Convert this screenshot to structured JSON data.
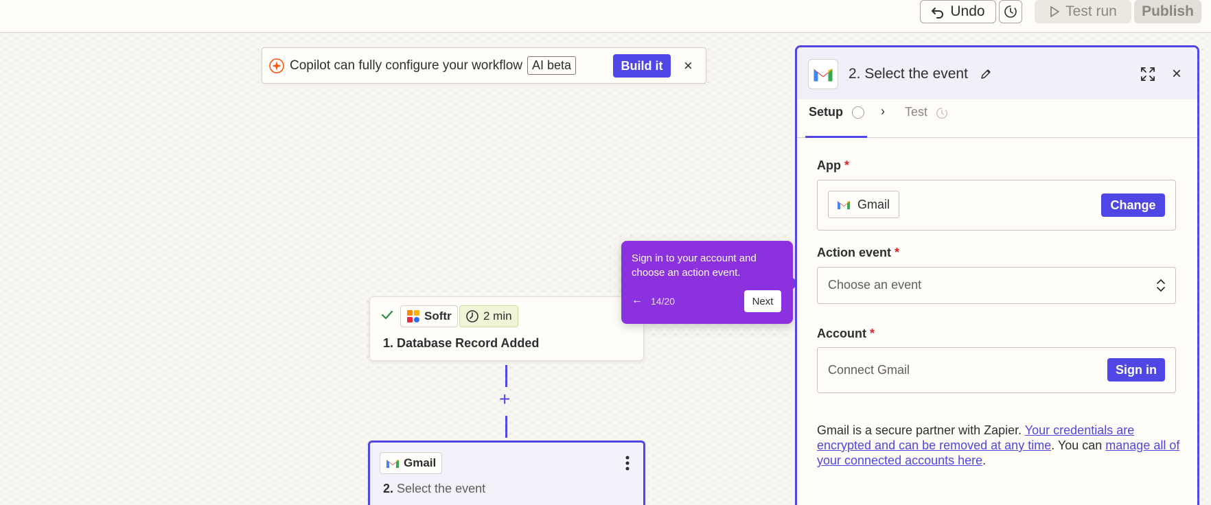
{
  "toolbar": {
    "undo_label": "Undo",
    "test_run_label": "Test run",
    "publish_label": "Publish"
  },
  "copilot": {
    "text": "Copilot can fully configure your workflow",
    "badge": "AI beta",
    "build_label": "Build it",
    "close_glyph": "×"
  },
  "steps": [
    {
      "app": "Softr",
      "duration": "2 min",
      "number": "1.",
      "title": "Database Record Added",
      "status": "complete"
    },
    {
      "app": "Gmail",
      "number": "2.",
      "title": "Select the event"
    }
  ],
  "connector": {
    "add_glyph": "+"
  },
  "tooltip": {
    "text": "Sign in to your account and choose an action event.",
    "back_glyph": "←",
    "progress": "14/20",
    "next_label": "Next"
  },
  "panel": {
    "title": "2. Select the event",
    "close_glyph": "×",
    "tabs": {
      "setup": "Setup",
      "test": "Test",
      "chevron": "›"
    },
    "app_field": {
      "label": "App",
      "required": "*",
      "value": "Gmail",
      "change_label": "Change"
    },
    "action_field": {
      "label": "Action event",
      "required": "*",
      "placeholder": "Choose an event"
    },
    "account_field": {
      "label": "Account",
      "required": "*",
      "placeholder": "Connect Gmail",
      "signin_label": "Sign in"
    },
    "partner_note": {
      "prefix": "Gmail is a secure partner with Zapier. ",
      "link1": "Your credentials are encrypted and can be removed at any time",
      "middle": ". You can ",
      "link2": "manage all of your connected accounts here",
      "suffix": "."
    }
  },
  "colors": {
    "accent": "#5046e5",
    "tooltip": "#8b31de",
    "required": "#d6262b",
    "canvas": "#f7f5ef"
  }
}
